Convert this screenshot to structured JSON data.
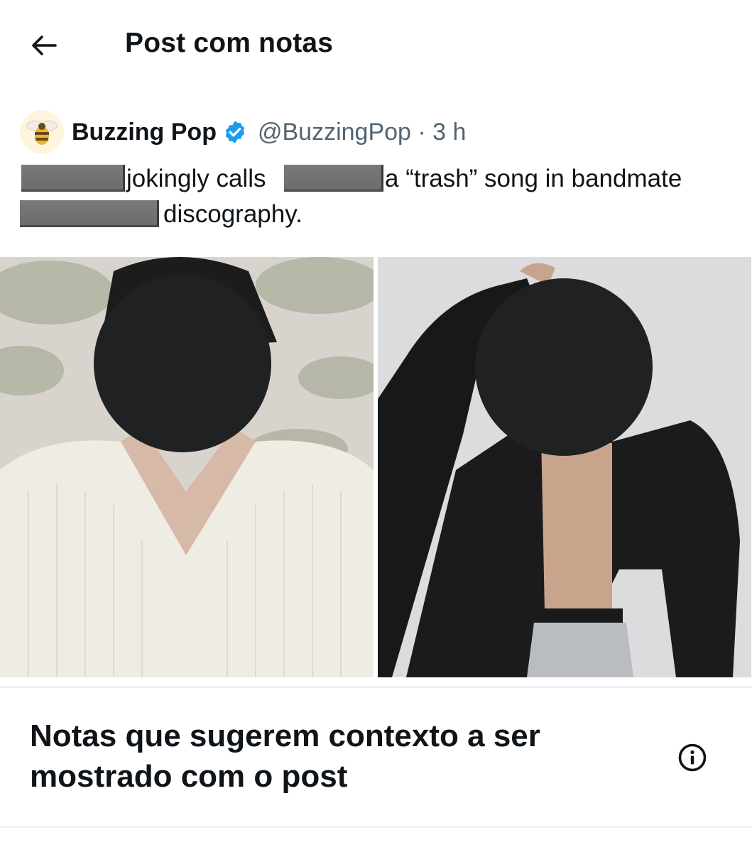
{
  "header": {
    "title": "Post com notas",
    "back_icon": "arrow-left-icon"
  },
  "post": {
    "author_name": "Buzzing Pop",
    "handle_time": "@BuzzingPop · 3 h",
    "verified_color": "#1d9bf0",
    "text_segments": {
      "seg1": "jokingly calls",
      "seg2": "a “trash” song in bandmate",
      "seg3": "discography."
    },
    "media": [
      {
        "icon": "photo-person-sweater",
        "face_redacted": true
      },
      {
        "icon": "photo-person-jacket",
        "face_redacted": true
      }
    ]
  },
  "notes": {
    "title": "Notas que sugerem contexto a ser mostrado com o post",
    "info_icon": "info-icon"
  }
}
